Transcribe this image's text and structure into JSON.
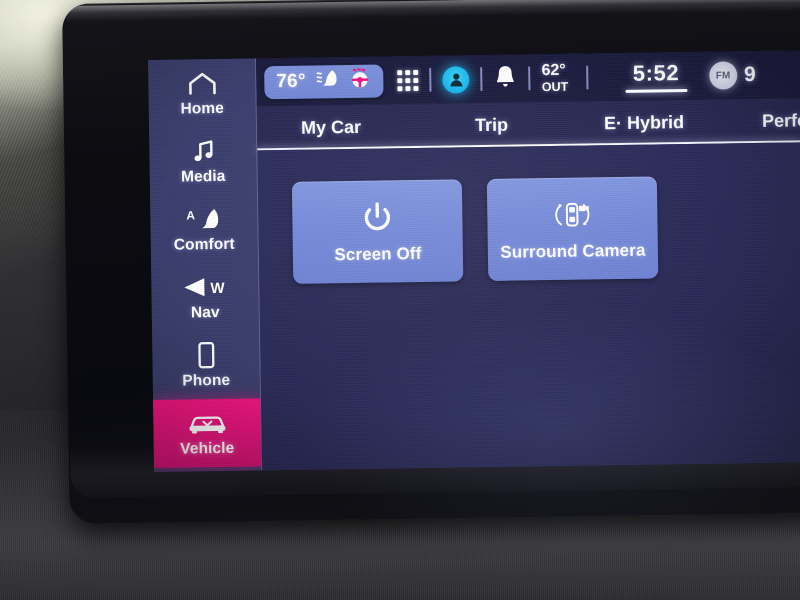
{
  "device": {
    "type": "vehicle-infotainment-touchscreen",
    "screen_label": "Vehicle settings screen"
  },
  "sidebar": {
    "items": [
      {
        "label": "Home",
        "icon": "home-icon",
        "active": false
      },
      {
        "label": "Media",
        "icon": "music-note-icon",
        "active": false
      },
      {
        "label": "Comfort",
        "icon": "seat-icon",
        "badge": "A",
        "active": false
      },
      {
        "label": "Nav",
        "icon": "navigation-arrow-icon",
        "badge": "W",
        "active": false
      },
      {
        "label": "Phone",
        "icon": "phone-icon",
        "active": false
      },
      {
        "label": "Vehicle",
        "icon": "car-icon",
        "active": true
      }
    ],
    "active_color": "#e8127e"
  },
  "statusbar": {
    "climate": {
      "temperature": "76°",
      "heated_seat_icon": "heated-seat-icon",
      "heated_steering_icon": "heated-steering-wheel-icon",
      "heated_steering_color": "#f0147e",
      "pill_color": "#7489d9"
    },
    "apps_icon": "app-grid-icon",
    "profile_icon": "user-profile-icon",
    "profile_color": "#18b8ef",
    "notifications_icon": "bell-icon",
    "outside_temp": {
      "value": "62°",
      "label": "OUT"
    },
    "clock": "5:52",
    "radio": {
      "band": "FM",
      "frequency": "9"
    }
  },
  "tabs": [
    {
      "label": "My Car",
      "selected": true
    },
    {
      "label": "Trip",
      "selected": false
    },
    {
      "label": "E· Hybrid",
      "selected": false
    },
    {
      "label": "Perform",
      "selected": false
    }
  ],
  "content": {
    "tiles": [
      {
        "label": "Screen Off",
        "icon": "power-icon"
      },
      {
        "label": "Surround Camera",
        "icon": "surround-camera-icon"
      }
    ],
    "tile_color": "#7489d9",
    "background_color": "#2a2a58"
  }
}
